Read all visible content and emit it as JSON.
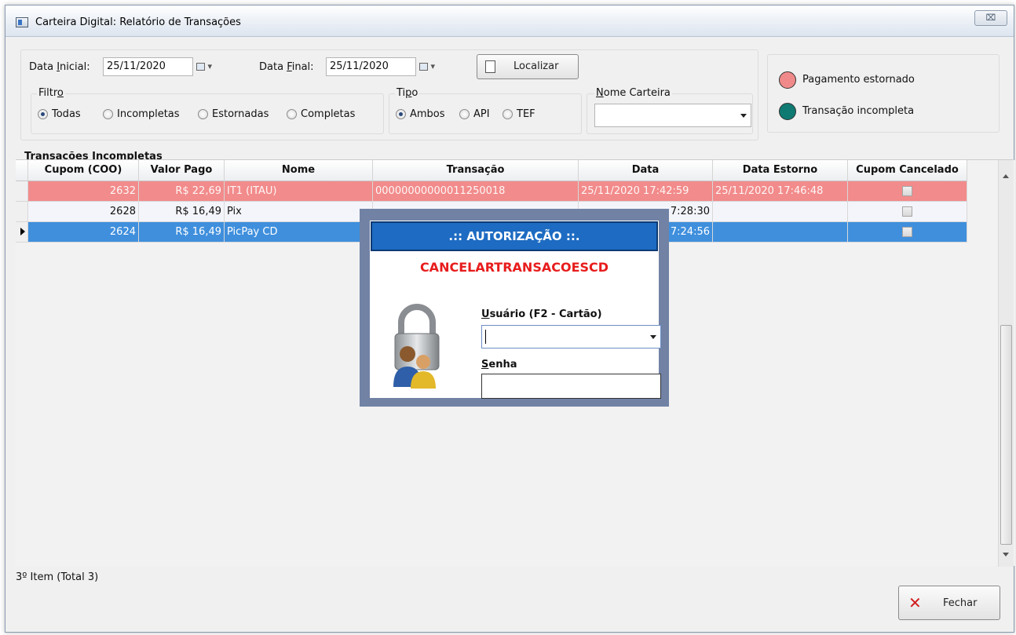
{
  "window": {
    "title": "Carteira Digital: Relatório de Transações",
    "close_symbol": "⌧"
  },
  "filters": {
    "data_inicial_label_prefix": "Data ",
    "data_inicial_label_accel": "I",
    "data_inicial_label_suffix": "nicial:",
    "data_inicial_value": "25/11/2020",
    "data_final_label_prefix": "Data ",
    "data_final_label_accel": "F",
    "data_final_label_suffix": "inal:",
    "data_final_value": "25/11/2020",
    "localizar_label": "Localizar",
    "filtro_label_prefix": "Filtr",
    "filtro_label_accel": "o",
    "filtro_options": [
      "Todas",
      "Incompletas",
      "Estornadas",
      "Completas"
    ],
    "filtro_selected": "Todas",
    "tipo_label_prefix": "Ti",
    "tipo_label_accel": "p",
    "tipo_label_suffix": "o",
    "tipo_options": [
      "Ambos",
      "API",
      "TEF"
    ],
    "tipo_selected": "Ambos",
    "nome_carteira_label_accel": "N",
    "nome_carteira_label_suffix": "ome Carteira",
    "nome_carteira_value": ""
  },
  "legend": [
    {
      "label": "Pagamento estornado",
      "color": "#f08a8a"
    },
    {
      "label": "Transação incompleta",
      "color": "#0f7a72"
    }
  ],
  "grid": {
    "title": "Transações Incompletas",
    "columns": [
      "Cupom (COO)",
      "Valor Pago",
      "Nome",
      "Transação",
      "Data",
      "Data Estorno",
      "Cupom Cancelado"
    ],
    "rows": [
      {
        "cupom": "2632",
        "valor": "R$ 22,69",
        "nome": "IT1 (ITAU)",
        "transacao": "00000000000011250018",
        "data": "25/11/2020 17:42:59",
        "estorno": "25/11/2020 17:46:48",
        "cancelado": false,
        "style": "red"
      },
      {
        "cupom": "2628",
        "valor": "R$ 16,49",
        "nome": "Pix",
        "transacao": "",
        "data": "7:28:30",
        "estorno": "",
        "cancelado": false,
        "style": "white"
      },
      {
        "cupom": "2624",
        "valor": "R$ 16,49",
        "nome": "PicPay CD",
        "transacao": "",
        "data": "7:24:56",
        "estorno": "",
        "cancelado": false,
        "style": "blue",
        "current": true
      }
    ]
  },
  "status": {
    "text": "3º Item (Total 3)"
  },
  "footer": {
    "fechar_label": "Fechar"
  },
  "colors": {
    "row_red": "#f28b8b",
    "row_blue": "#3f8fdd",
    "modal_header": "#1d6bc2",
    "modal_code": "#e81c1c"
  },
  "dialog": {
    "title": ".:: AUTORIZAÇÃO ::.",
    "code": "CANCELARTRANSACOESCD",
    "usuario_label_accel": "U",
    "usuario_label_suffix": "suário (F2 - Cartão)",
    "usuario_value": "",
    "senha_label_accel": "S",
    "senha_label_suffix": "enha",
    "senha_value": "",
    "icon": "lock-users-icon"
  }
}
